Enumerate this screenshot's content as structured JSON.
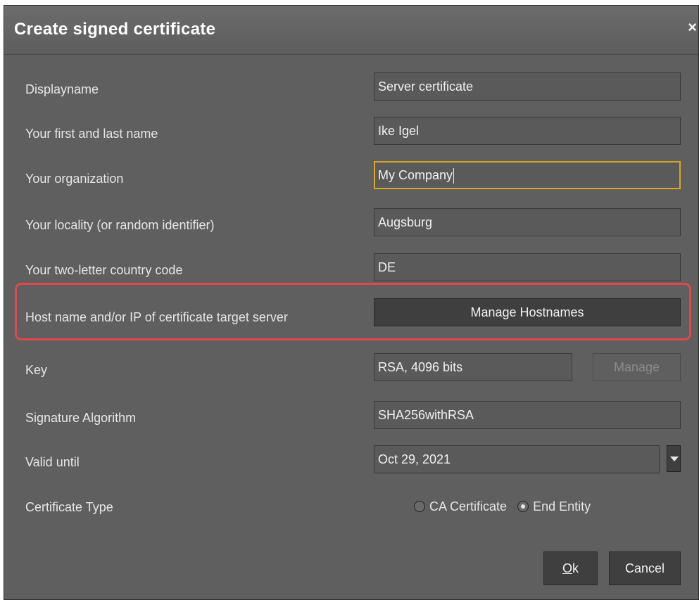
{
  "dialog": {
    "title": "Create signed certificate",
    "close_glyph": "×"
  },
  "fields": {
    "displayname": {
      "label": "Displayname",
      "value": "Server certificate"
    },
    "name": {
      "label": "Your first and last name",
      "value": "Ike Igel"
    },
    "organization": {
      "label": "Your organization",
      "value": "My Company"
    },
    "locality": {
      "label": "Your locality (or random identifier)",
      "value": "Augsburg"
    },
    "country": {
      "label": "Your two-letter country code",
      "value": "DE"
    },
    "hostname": {
      "label": "Host name and/or IP of certificate target server",
      "button": "Manage Hostnames"
    },
    "key": {
      "label": "Key",
      "value": "RSA, 4096 bits",
      "button": "Manage"
    },
    "signature": {
      "label": "Signature Algorithm",
      "value": "SHA256withRSA"
    },
    "valid_until": {
      "label": "Valid until",
      "value": "Oct 29, 2021"
    },
    "cert_type": {
      "label": "Certificate Type",
      "options": [
        "CA Certificate",
        "End Entity"
      ],
      "selected": "End Entity"
    }
  },
  "buttons": {
    "ok_mnemonic": "O",
    "ok_rest": "k",
    "cancel": "Cancel"
  },
  "colors": {
    "highlight": "#e2474c",
    "focus": "#d6a72a"
  }
}
